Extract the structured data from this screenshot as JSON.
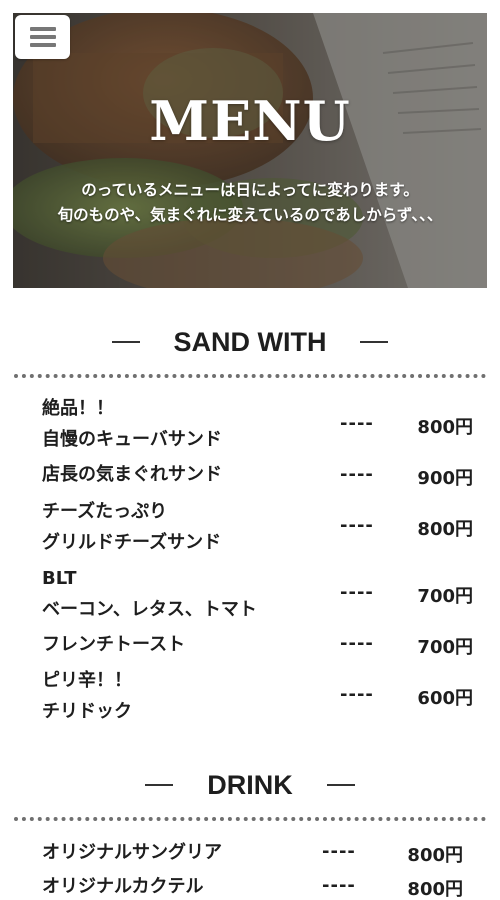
{
  "header": {
    "menu_icon": "hamburger-icon",
    "title": "MENU",
    "intro_line1": "のっているメニューは日によってに変わります。",
    "intro_line2": "旬のものや、気まぐれに変えているのであしからず、、、"
  },
  "sections": {
    "sandwich": {
      "heading": "SAND WITH",
      "items": [
        {
          "line1": "絶品！！",
          "line2": "自慢のキューバサンド",
          "dash": "----",
          "price": "800円"
        },
        {
          "line1": "店長の気まぐれサンド",
          "line2": "",
          "dash": "----",
          "price": "900円"
        },
        {
          "line1": "チーズたっぷり",
          "line2": "グリルドチーズサンド",
          "dash": "----",
          "price": "800円"
        },
        {
          "line1": "BLT",
          "line2": "ベーコン、レタス、トマト",
          "dash": "----",
          "price": "700円"
        },
        {
          "line1": "フレンチトースト",
          "line2": "",
          "dash": "----",
          "price": "700円"
        },
        {
          "line1": "ピリ辛！！",
          "line2": "チリドック",
          "dash": "----",
          "price": "600円"
        }
      ]
    },
    "drink": {
      "heading": "DRINK",
      "items": [
        {
          "line1": "オリジナルサングリア",
          "dash": "----",
          "price": "800円"
        },
        {
          "line1": "オリジナルカクテル",
          "dash": "----",
          "price": "800円"
        }
      ]
    }
  }
}
